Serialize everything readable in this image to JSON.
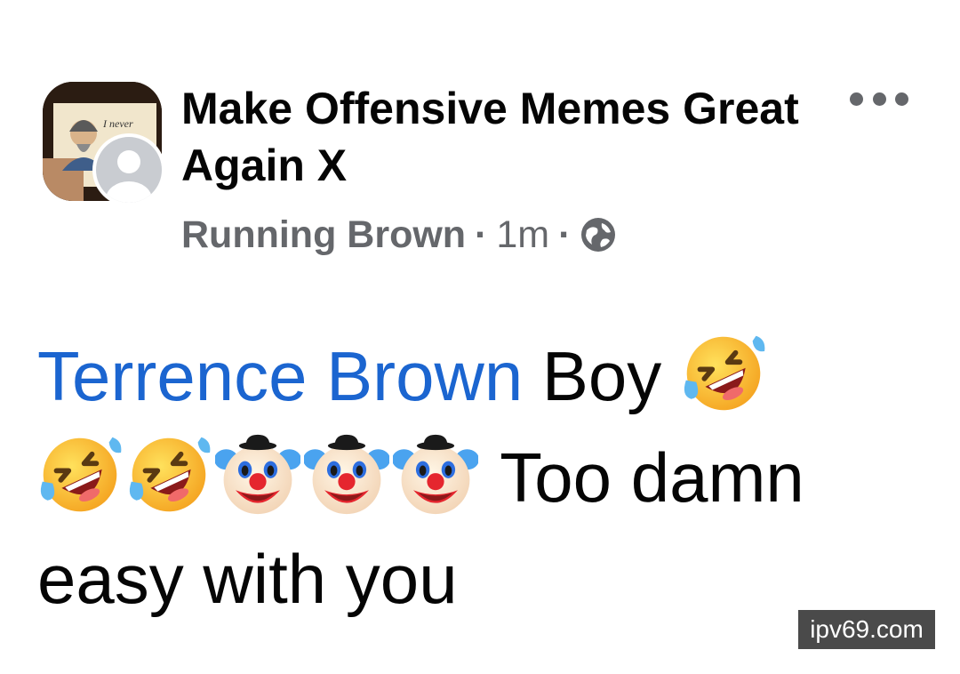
{
  "post": {
    "group_name": "Make Offensive Memes Great Again X",
    "author": "Running Brown",
    "separator": "·",
    "time": "1m",
    "privacy_icon": "globe-icon",
    "more_icon": "more-options-icon",
    "text": {
      "mention": "Terrence Brown",
      "part1": " Boy ",
      "part2": " Too damn easy with you"
    },
    "emojis": [
      "rolling-on-floor-laughing",
      "rolling-on-floor-laughing",
      "rolling-on-floor-laughing",
      "clown-face",
      "clown-face",
      "clown-face"
    ],
    "group_avatar_caption": "I never"
  },
  "watermark": "ipv69.com",
  "colors": {
    "mention": "#1b65d0",
    "meta_gray": "#65676b",
    "text": "#050505"
  }
}
